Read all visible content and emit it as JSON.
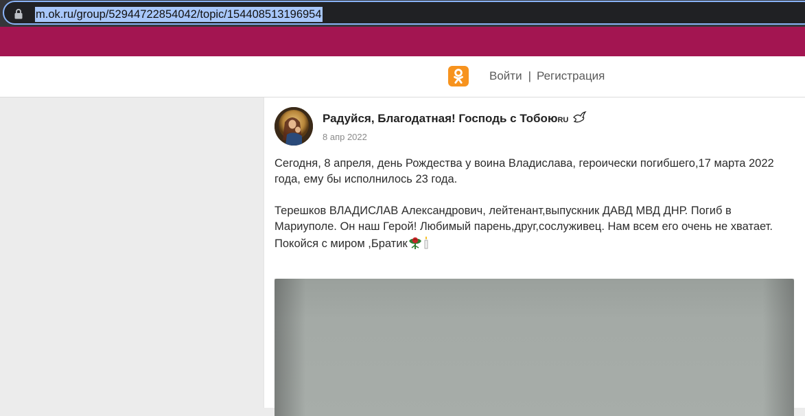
{
  "browser": {
    "url": "m.ok.ru/group/52944722854042/topic/154408513196954",
    "lock_icon": "lock-icon"
  },
  "header": {
    "logo_icon": "odnoklassniki-logo",
    "login_label": "Войти",
    "separator": "|",
    "register_label": "Регистрация"
  },
  "post": {
    "group_name": "Радуйся, Благодатная! Господь с Тобою",
    "group_name_suffix": "RU",
    "group_icon": "dove-icon",
    "date": "8 апр 2022",
    "paragraph_1": "Сегодня, 8 апреля, день Рождества у воина Владислава, героически погибшего,17 марта 2022 года, ему бы исполнилось 23 года.",
    "paragraph_2": "Терешков ВЛАДИСЛАВ Александрович, лейтенант,выпускник ДАВД МВД ДНР. Погиб в Мариуполе. Он наш Герой! Любимый парень,друг,сослуживец. Нам всем его очень не хватает.",
    "paragraph_3": "Покойся с миром ,Братик",
    "trailing_icons": [
      "rose-icon",
      "candle-icon"
    ]
  },
  "colors": {
    "brand_strip": "#a31551",
    "ok_orange": "#f7931e",
    "url_highlight": "#a8c7fa"
  }
}
